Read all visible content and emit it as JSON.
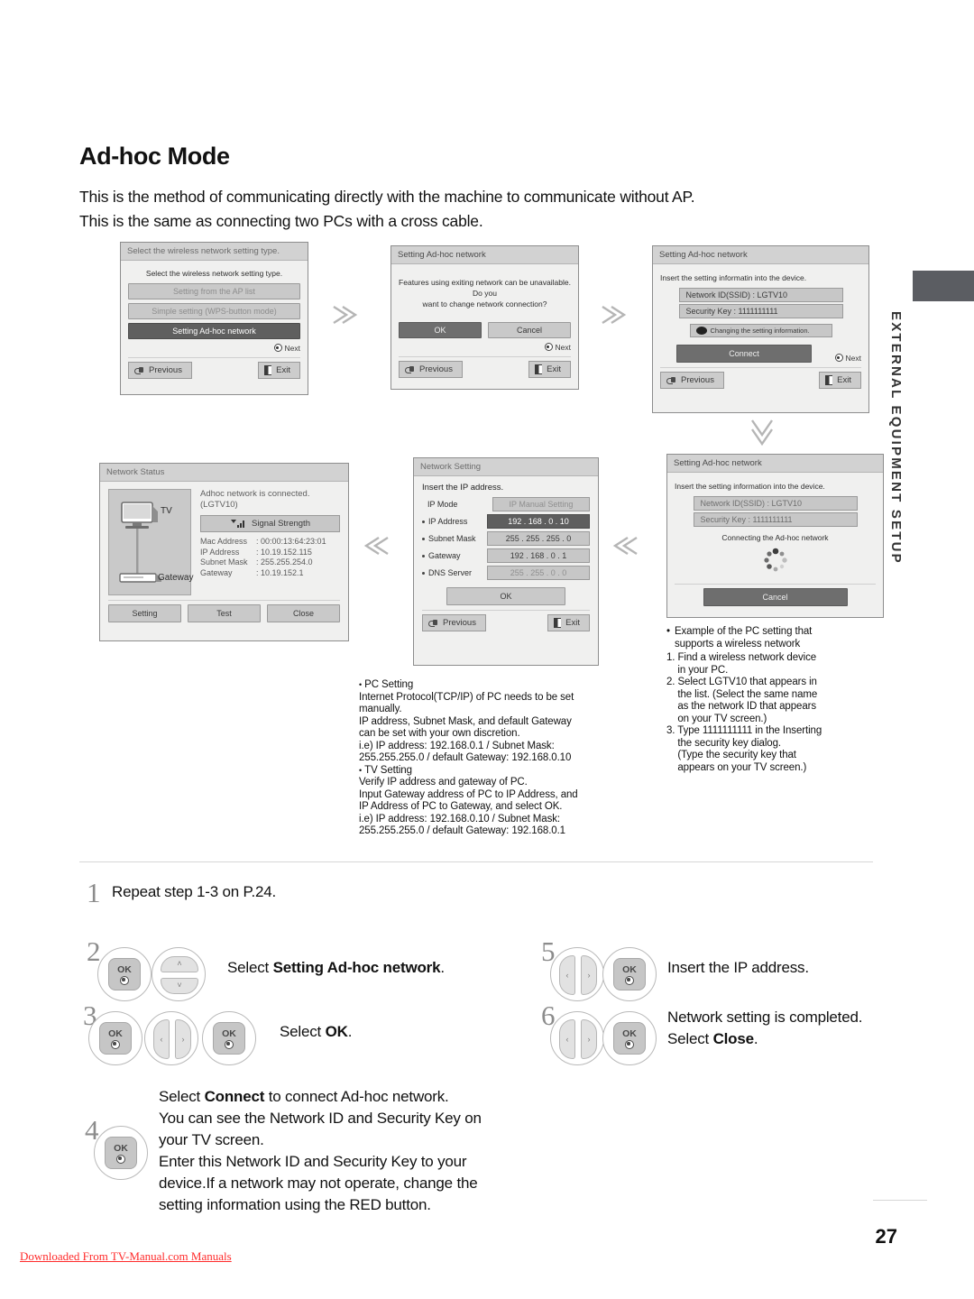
{
  "page": {
    "title": "Ad-hoc Mode",
    "intro_line1": "This is the method of communicating directly with the machine to communicate without AP.",
    "intro_line2": "This is the same as connecting two PCs with a cross cable.",
    "side_tab": "EXTERNAL EQUIPMENT SETUP",
    "page_number": "27",
    "download_notice": "Downloaded From TV-Manual.com Manuals"
  },
  "dialogs": {
    "select_type": {
      "titlebar": "Select the wireless network setting type.",
      "prompt": "Select the wireless network setting type.",
      "options": [
        "Setting from the AP list",
        "Simple setting (WPS-button mode)",
        "Setting Ad-hoc network"
      ],
      "next": "Next",
      "previous": "Previous",
      "exit": "Exit"
    },
    "confirm": {
      "titlebar": "Setting Ad-hoc network",
      "message_line1": "Features using exiting network can be unavailable. Do you",
      "message_line2": "want to change network connection?",
      "ok": "OK",
      "cancel": "Cancel",
      "next": "Next",
      "previous": "Previous",
      "exit": "Exit"
    },
    "info": {
      "titlebar": "Setting Ad-hoc network",
      "prompt": "Insert the setting informatin into the device.",
      "network_id": "Network ID(SSID) : LGTV10",
      "security_key": "Security Key : 1111111111",
      "change_hint": "Changing the setting information.",
      "connect": "Connect",
      "next": "Next",
      "previous": "Previous",
      "exit": "Exit"
    },
    "connecting": {
      "titlebar": "Setting Ad-hoc network",
      "prompt": "Insert the setting information into the device.",
      "network_id": "Network ID(SSID) : LGTV10",
      "security_key": "Security Key : 1111111111",
      "status": "Connecting the Ad-hoc network",
      "cancel": "Cancel"
    },
    "network_setting": {
      "titlebar": "Network Setting",
      "prompt": "Insert the IP address.",
      "ip_mode_label": "IP Mode",
      "ip_mode_value": "IP Manual Setting",
      "rows": [
        {
          "label": "IP Address",
          "value": "192 . 168 . 0 . 10"
        },
        {
          "label": "Subnet Mask",
          "value": "255 . 255 . 255 . 0"
        },
        {
          "label": "Gateway",
          "value": "192 . 168 . 0 . 1"
        },
        {
          "label": "DNS Server",
          "value": "255 . 255 . 0 . 0"
        }
      ],
      "ok": "OK",
      "previous": "Previous",
      "exit": "Exit"
    },
    "network_status": {
      "titlebar": "Network Status",
      "tv_label": "TV",
      "gateway_label": "Gateway",
      "status_line1": "Adhoc network is connected.",
      "status_line2": "(LGTV10)",
      "signal_button": "Signal Strength",
      "details": [
        {
          "label": "Mac Address",
          "value": ": 00:00:13:64:23:01"
        },
        {
          "label": "IP Address",
          "value": ": 10.19.152.115"
        },
        {
          "label": "Subnet Mask",
          "value": ": 255.255.254.0"
        },
        {
          "label": "Gateway",
          "value": ": 10.19.152.1"
        }
      ],
      "setting": "Setting",
      "test": "Test",
      "close": "Close"
    }
  },
  "notes": {
    "pc_setting_heading": "PC Setting",
    "pc_setting_lines": [
      "Internet Protocol(TCP/IP) of PC needs to be set",
      "manually.",
      "IP address, Subnet Mask, and default Gateway",
      "can be set with your own discretion.",
      "i.e) IP address: 192.168.0.1 / Subnet Mask:",
      "255.255.255.0 / default Gateway: 192.168.0.10"
    ],
    "tv_setting_heading": "TV Setting",
    "tv_setting_lines": [
      "Verify IP address and gateway of PC.",
      "Input Gateway address of PC to IP Address, and",
      "IP Address of PC to Gateway, and select OK.",
      "i.e) IP address: 192.168.0.10 / Subnet Mask:",
      "255.255.255.0 / default Gateway: 192.168.0.1"
    ],
    "example_heading_line1": "Example of the PC setting that",
    "example_heading_line2": "supports a wireless network",
    "example_steps": [
      "1. Find a wireless network device",
      "    in your PC.",
      "2. Select LGTV10 that appears in",
      "    the list. (Select the same name",
      "    as the network ID that appears",
      "    on your TV screen.)",
      "3. Type 1111111111 in the Inserting",
      "    the security key dialog.",
      "    (Type the security key that",
      "    appears on your TV screen.)"
    ]
  },
  "steps": {
    "s1": {
      "num": "1",
      "text": "Repeat step 1-3 on P.24."
    },
    "s2": {
      "num": "2",
      "text_pre": "Select ",
      "text_bold": "Setting Ad-hoc network",
      "text_post": "."
    },
    "s3": {
      "num": "3",
      "text_pre": "Select ",
      "text_bold": "OK",
      "text_post": "."
    },
    "s4": {
      "num": "4",
      "line1_pre": "Select ",
      "line1_bold": "Connect",
      "line1_post": " to connect Ad-hoc network.",
      "line2": "You can see the Network ID and Security Key on",
      "line3": "your TV screen.",
      "line4": "Enter this Network ID and Security Key to your",
      "line5": "device.If a network may not operate, change the",
      "line6": "setting information using the RED button."
    },
    "s5": {
      "num": "5",
      "text": "Insert the IP address."
    },
    "s6": {
      "num": "6",
      "line1": "Network setting is completed.",
      "line2_pre": "Select ",
      "line2_bold": "Close",
      "line2_post": "."
    }
  },
  "icons": {
    "ok": "OK",
    "up": "˄",
    "down": "˅",
    "left": "‹",
    "right": "›"
  }
}
